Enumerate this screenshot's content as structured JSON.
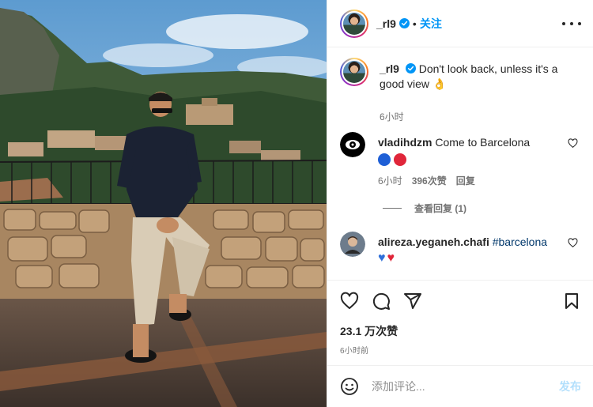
{
  "post": {
    "username": "_rl9",
    "verified": true,
    "follow_label": "关注",
    "more_icon": "more-horizontal-icon"
  },
  "caption": {
    "username": "_rl9",
    "text": "Don't look back, unless it's a good view",
    "emoji": "👌",
    "time": "6小时"
  },
  "comments": [
    {
      "username": "vladihdzm",
      "text": "Come to Barcelona",
      "emojis": [
        "🔵",
        "🔴"
      ],
      "emoji_colors": [
        "#1e5fd6",
        "#e0263a"
      ],
      "time": "6小时",
      "likes": "396次赞",
      "reply_label": "回复",
      "view_replies": "查看回复 (1)"
    },
    {
      "username": "alireza.yeganeh.chafi",
      "hashtag": "#barcelona",
      "emojis": [
        "💙",
        "❤️"
      ],
      "emoji_colors": [
        "#2f6fd9",
        "#e0263a"
      ]
    }
  ],
  "actions": {
    "likes_count": "23.1 万次赞",
    "post_time": "6小时前"
  },
  "comment_box": {
    "placeholder": "添加评论...",
    "post_label": "发布"
  },
  "colors": {
    "accent": "#0095f6",
    "muted": "#737373",
    "border": "#efefef"
  }
}
